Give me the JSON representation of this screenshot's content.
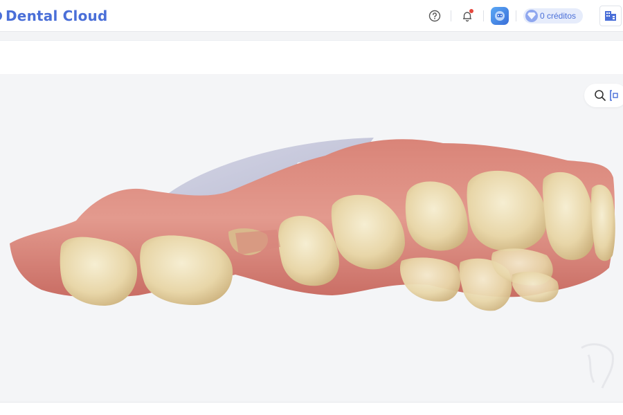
{
  "app": {
    "title": "Dental Cloud",
    "brand_color": "#4a6fd8"
  },
  "header": {
    "help_icon": "help-circle-icon",
    "notification_icon": "bell-icon",
    "notification_badge_color": "#e5483d",
    "avatar_icon": "user-avatar-icon",
    "credits_label": "0 créditos",
    "credits_icon": "diamond-icon",
    "org_icon": "organization-icon"
  },
  "viewer": {
    "background": "#f4f5f7",
    "tools": [
      "zoom-icon",
      "fit-view-icon"
    ],
    "content": "3d-dental-scan-model"
  }
}
